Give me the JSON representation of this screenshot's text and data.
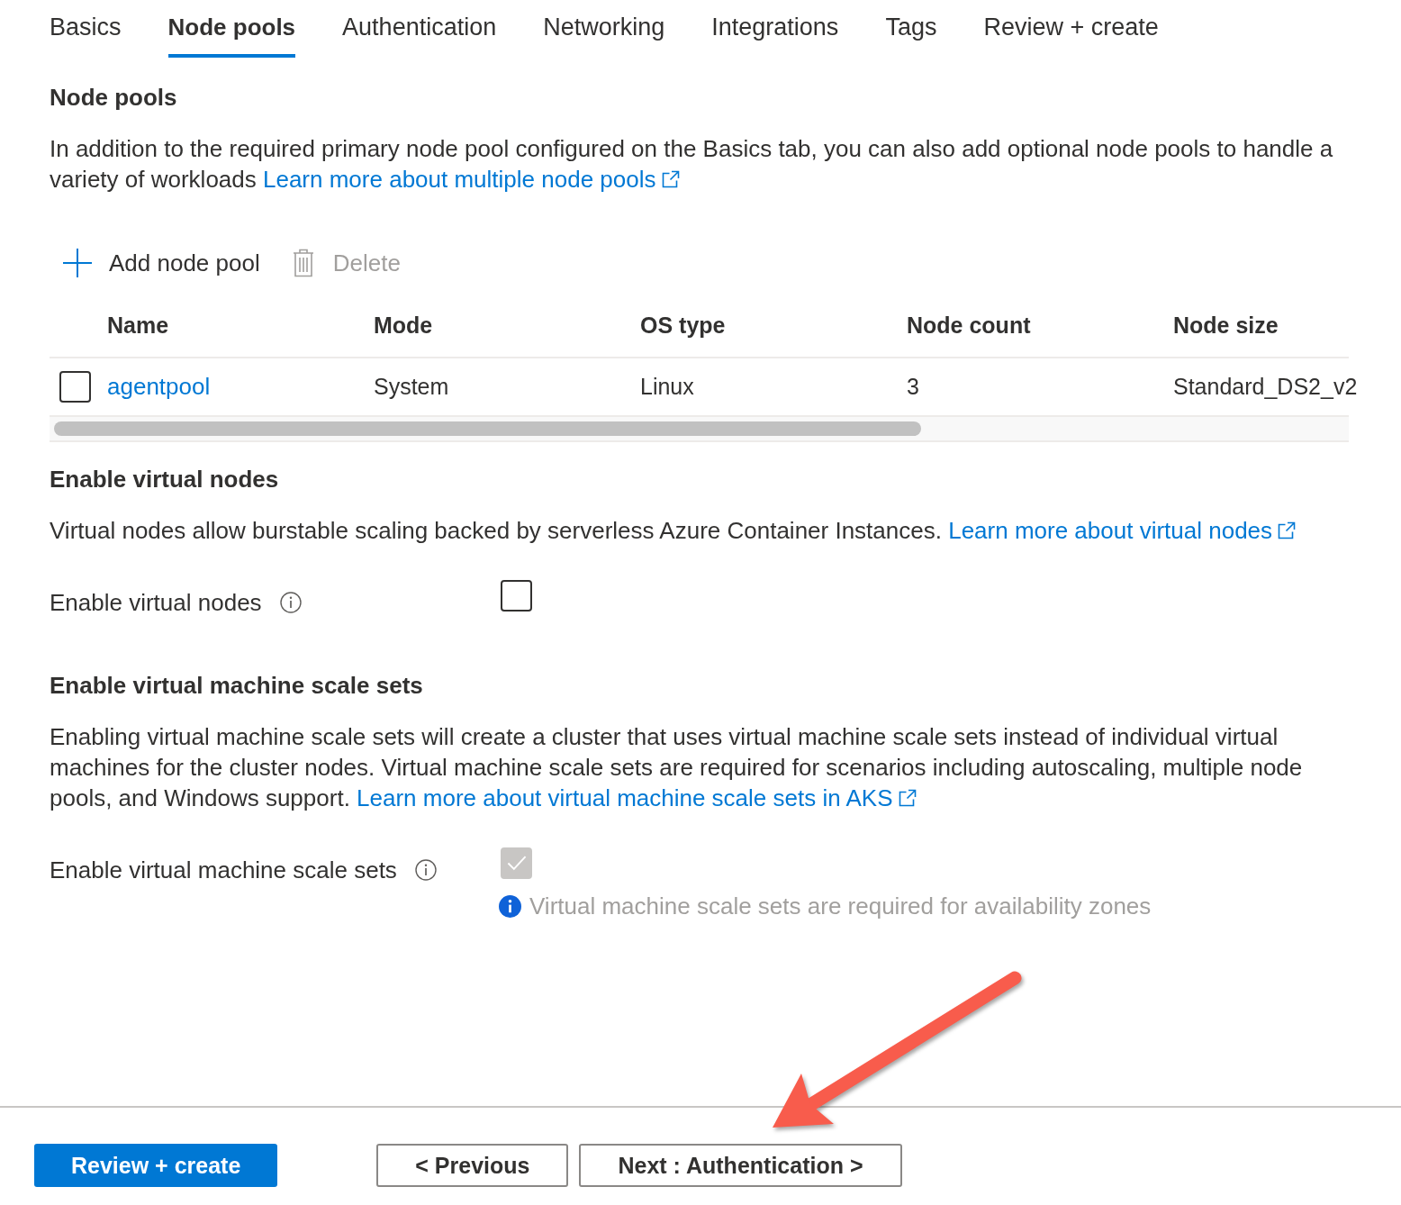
{
  "tabs": [
    {
      "label": "Basics",
      "selected": false
    },
    {
      "label": "Node pools",
      "selected": true
    },
    {
      "label": "Authentication",
      "selected": false
    },
    {
      "label": "Networking",
      "selected": false
    },
    {
      "label": "Integrations",
      "selected": false
    },
    {
      "label": "Tags",
      "selected": false
    },
    {
      "label": "Review + create",
      "selected": false
    }
  ],
  "node_pools": {
    "heading": "Node pools",
    "description": "In addition to the required primary node pool configured on the Basics tab, you can also add optional node pools to handle a variety of workloads",
    "link": "Learn more about multiple node pools",
    "toolbar": [
      {
        "kind": "add",
        "label": "Add node pool",
        "disabled": false
      },
      {
        "kind": "delete",
        "label": "Delete",
        "disabled": true
      }
    ],
    "table": {
      "columns": [
        "Name",
        "Mode",
        "OS type",
        "Node count",
        "Node size"
      ],
      "rows": [
        {
          "checked": false,
          "cells": [
            "agentpool",
            "System",
            "Linux",
            "3",
            "Standard_DS2_v2"
          ]
        }
      ]
    }
  },
  "virtual_nodes": {
    "heading": "Enable virtual nodes",
    "description": "Virtual nodes allow burstable scaling backed by serverless Azure Container Instances.",
    "link": "Learn more about virtual nodes",
    "field": {
      "label": "Enable virtual nodes",
      "checked": false,
      "disabled": false
    }
  },
  "vmss": {
    "heading": "Enable virtual machine scale sets",
    "description": "Enabling virtual machine scale sets will create a cluster that uses virtual machine scale sets instead of individual virtual machines for the cluster nodes. Virtual machine scale sets are required for scenarios including autoscaling, multiple node pools, and Windows support.",
    "link": "Learn more about virtual machine scale sets in AKS",
    "field": {
      "label": "Enable virtual machine scale sets",
      "checked": true,
      "disabled": true,
      "message": "Virtual machine scale sets are required for availability zones"
    }
  },
  "footer": {
    "buttons": [
      {
        "kind": "submit",
        "label": "Review + create"
      },
      {
        "kind": "back",
        "label": "< Previous"
      },
      {
        "kind": "next",
        "label": "Next : Authentication >"
      }
    ]
  },
  "annotations": [
    {
      "kind": "arrow"
    }
  ]
}
